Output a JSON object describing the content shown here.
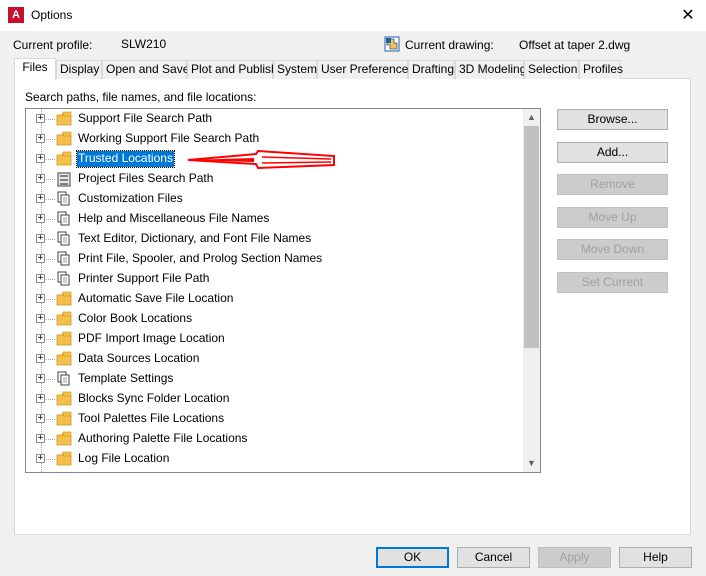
{
  "window": {
    "title": "Options",
    "close_glyph": "✕",
    "app_icon_letter": "A"
  },
  "header": {
    "profile_label": "Current profile:",
    "profile_value": "SLW210",
    "drawing_label": "Current drawing:",
    "drawing_value": "Offset at taper 2.dwg"
  },
  "tabs": [
    {
      "label": "Files",
      "active": true
    },
    {
      "label": "Display"
    },
    {
      "label": "Open and Save"
    },
    {
      "label": "Plot and Publish"
    },
    {
      "label": "System"
    },
    {
      "label": "User Preferences"
    },
    {
      "label": "Drafting"
    },
    {
      "label": "3D Modeling"
    },
    {
      "label": "Selection"
    },
    {
      "label": "Profiles"
    }
  ],
  "files": {
    "section_label": "Search paths, file names, and file locations:",
    "expander_glyph": "+",
    "items": [
      {
        "label": "Support File Search Path",
        "icon": "folder-icon"
      },
      {
        "label": "Working Support File Search Path",
        "icon": "folder-icon"
      },
      {
        "label": "Trusted Locations",
        "icon": "folder-icon",
        "selected": true
      },
      {
        "label": "Project Files Search Path",
        "icon": "cabinet-icon"
      },
      {
        "label": "Customization Files",
        "icon": "files-icon"
      },
      {
        "label": "Help and Miscellaneous File Names",
        "icon": "files-icon"
      },
      {
        "label": "Text Editor, Dictionary, and Font File Names",
        "icon": "files-icon"
      },
      {
        "label": "Print File, Spooler, and Prolog Section Names",
        "icon": "files-icon"
      },
      {
        "label": "Printer Support File Path",
        "icon": "files-icon"
      },
      {
        "label": "Automatic Save File Location",
        "icon": "folder-icon"
      },
      {
        "label": "Color Book Locations",
        "icon": "folder-icon"
      },
      {
        "label": "PDF Import Image Location",
        "icon": "folder-icon"
      },
      {
        "label": "Data Sources Location",
        "icon": "folder-icon"
      },
      {
        "label": "Template Settings",
        "icon": "files-icon"
      },
      {
        "label": "Blocks Sync Folder Location",
        "icon": "folder-icon"
      },
      {
        "label": "Tool Palettes File Locations",
        "icon": "folder-icon"
      },
      {
        "label": "Authoring Palette File Locations",
        "icon": "folder-icon"
      },
      {
        "label": "Log File Location",
        "icon": "folder-icon"
      }
    ]
  },
  "side_buttons": [
    {
      "label": "Browse...",
      "enabled": true
    },
    {
      "label": "Add...",
      "enabled": true
    },
    {
      "label": "Remove",
      "enabled": false
    },
    {
      "label": "Move Up",
      "enabled": false
    },
    {
      "label": "Move Down",
      "enabled": false
    },
    {
      "label": "Set Current",
      "enabled": false
    }
  ],
  "scrollbar": {
    "up_glyph": "▲",
    "down_glyph": "▼"
  },
  "footer": {
    "ok_label": "OK",
    "cancel_label": "Cancel",
    "apply_label": "Apply",
    "help_label": "Help"
  },
  "colors": {
    "selection": "#0078d7",
    "annotation_arrow": "#ff0000",
    "folder": "#f5c04a",
    "app_icon": "#c8102e"
  }
}
